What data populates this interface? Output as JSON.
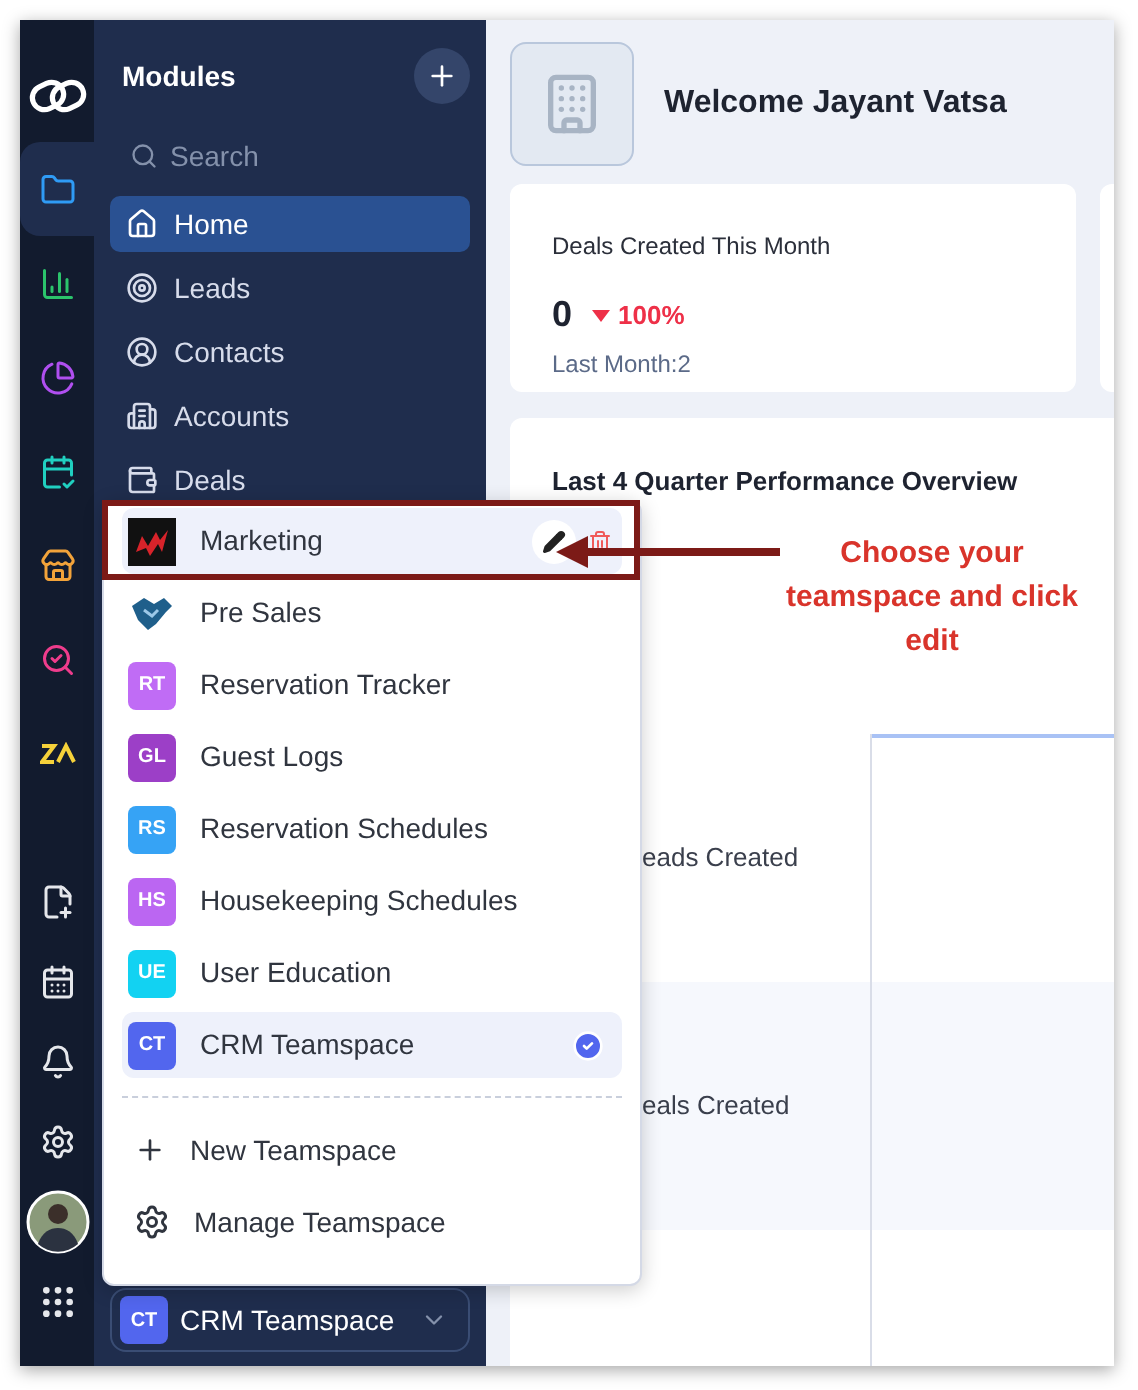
{
  "rail": {
    "top": [
      {
        "kind": "logo",
        "selected": false
      },
      {
        "kind": "modules",
        "selected": true
      },
      {
        "kind": "reports",
        "selected": false
      },
      {
        "kind": "analytics",
        "selected": false
      },
      {
        "kind": "planner",
        "selected": false
      },
      {
        "kind": "store",
        "selected": false
      },
      {
        "kind": "search",
        "selected": false
      },
      {
        "kind": "zia",
        "selected": false
      }
    ],
    "bottom": [
      {
        "kind": "note"
      },
      {
        "kind": "calendar"
      },
      {
        "kind": "bell"
      },
      {
        "kind": "settings"
      },
      {
        "kind": "avatar"
      },
      {
        "kind": "apps"
      }
    ]
  },
  "sidebar": {
    "title": "Modules",
    "search": {
      "placeholder": "Search"
    },
    "items": [
      {
        "kind": "home",
        "label": "Home",
        "selected": true
      },
      {
        "kind": "leads",
        "label": "Leads",
        "selected": false
      },
      {
        "kind": "contacts",
        "label": "Contacts",
        "selected": false
      },
      {
        "kind": "accounts",
        "label": "Accounts",
        "selected": false
      },
      {
        "kind": "deals",
        "label": "Deals",
        "selected": false
      }
    ],
    "teamspace_button": {
      "initials": "CT",
      "label": "CRM Teamspace"
    }
  },
  "main": {
    "welcome": "Welcome Jayant Vatsa",
    "kpi": {
      "title": "Deals Created This Month",
      "value": "0",
      "change": "100%",
      "previous": "Last Month:2"
    },
    "performance": {
      "title": "Last 4 Quarter Performance Overview",
      "rows": [
        {
          "label": "eads Created"
        },
        {
          "label": "eals Created"
        }
      ]
    }
  },
  "teamspace_menu": {
    "items": [
      {
        "kind": "zigzag_logo",
        "label": "Marketing",
        "selected": false,
        "hovered": true
      },
      {
        "kind": "handshake_logo",
        "label": "Pre Sales",
        "selected": false,
        "hovered": false
      },
      {
        "kind": "initials",
        "initials": "RT",
        "color": "#c06cf5",
        "label": "Reservation Tracker",
        "selected": false,
        "hovered": false
      },
      {
        "kind": "initials",
        "initials": "GL",
        "color": "#9c3fc7",
        "label": "Guest Logs",
        "selected": false,
        "hovered": false
      },
      {
        "kind": "initials",
        "initials": "RS",
        "color": "#36a3f5",
        "label": "Reservation Schedules",
        "selected": false,
        "hovered": false
      },
      {
        "kind": "initials",
        "initials": "HS",
        "color": "#bb66f2",
        "label": "Housekeeping Schedules",
        "selected": false,
        "hovered": false
      },
      {
        "kind": "initials",
        "initials": "UE",
        "color": "#12d2f2",
        "label": "User Education",
        "selected": false,
        "hovered": false
      },
      {
        "kind": "initials",
        "initials": "CT",
        "color": "#5266ee",
        "label": "CRM Teamspace",
        "selected": true,
        "hovered": false
      }
    ],
    "actions": [
      {
        "kind": "new",
        "label": "New Teamspace"
      },
      {
        "kind": "manage",
        "label": "Manage Teamspace"
      }
    ]
  },
  "annotation": {
    "text": "Choose your teamspace and click edit"
  }
}
